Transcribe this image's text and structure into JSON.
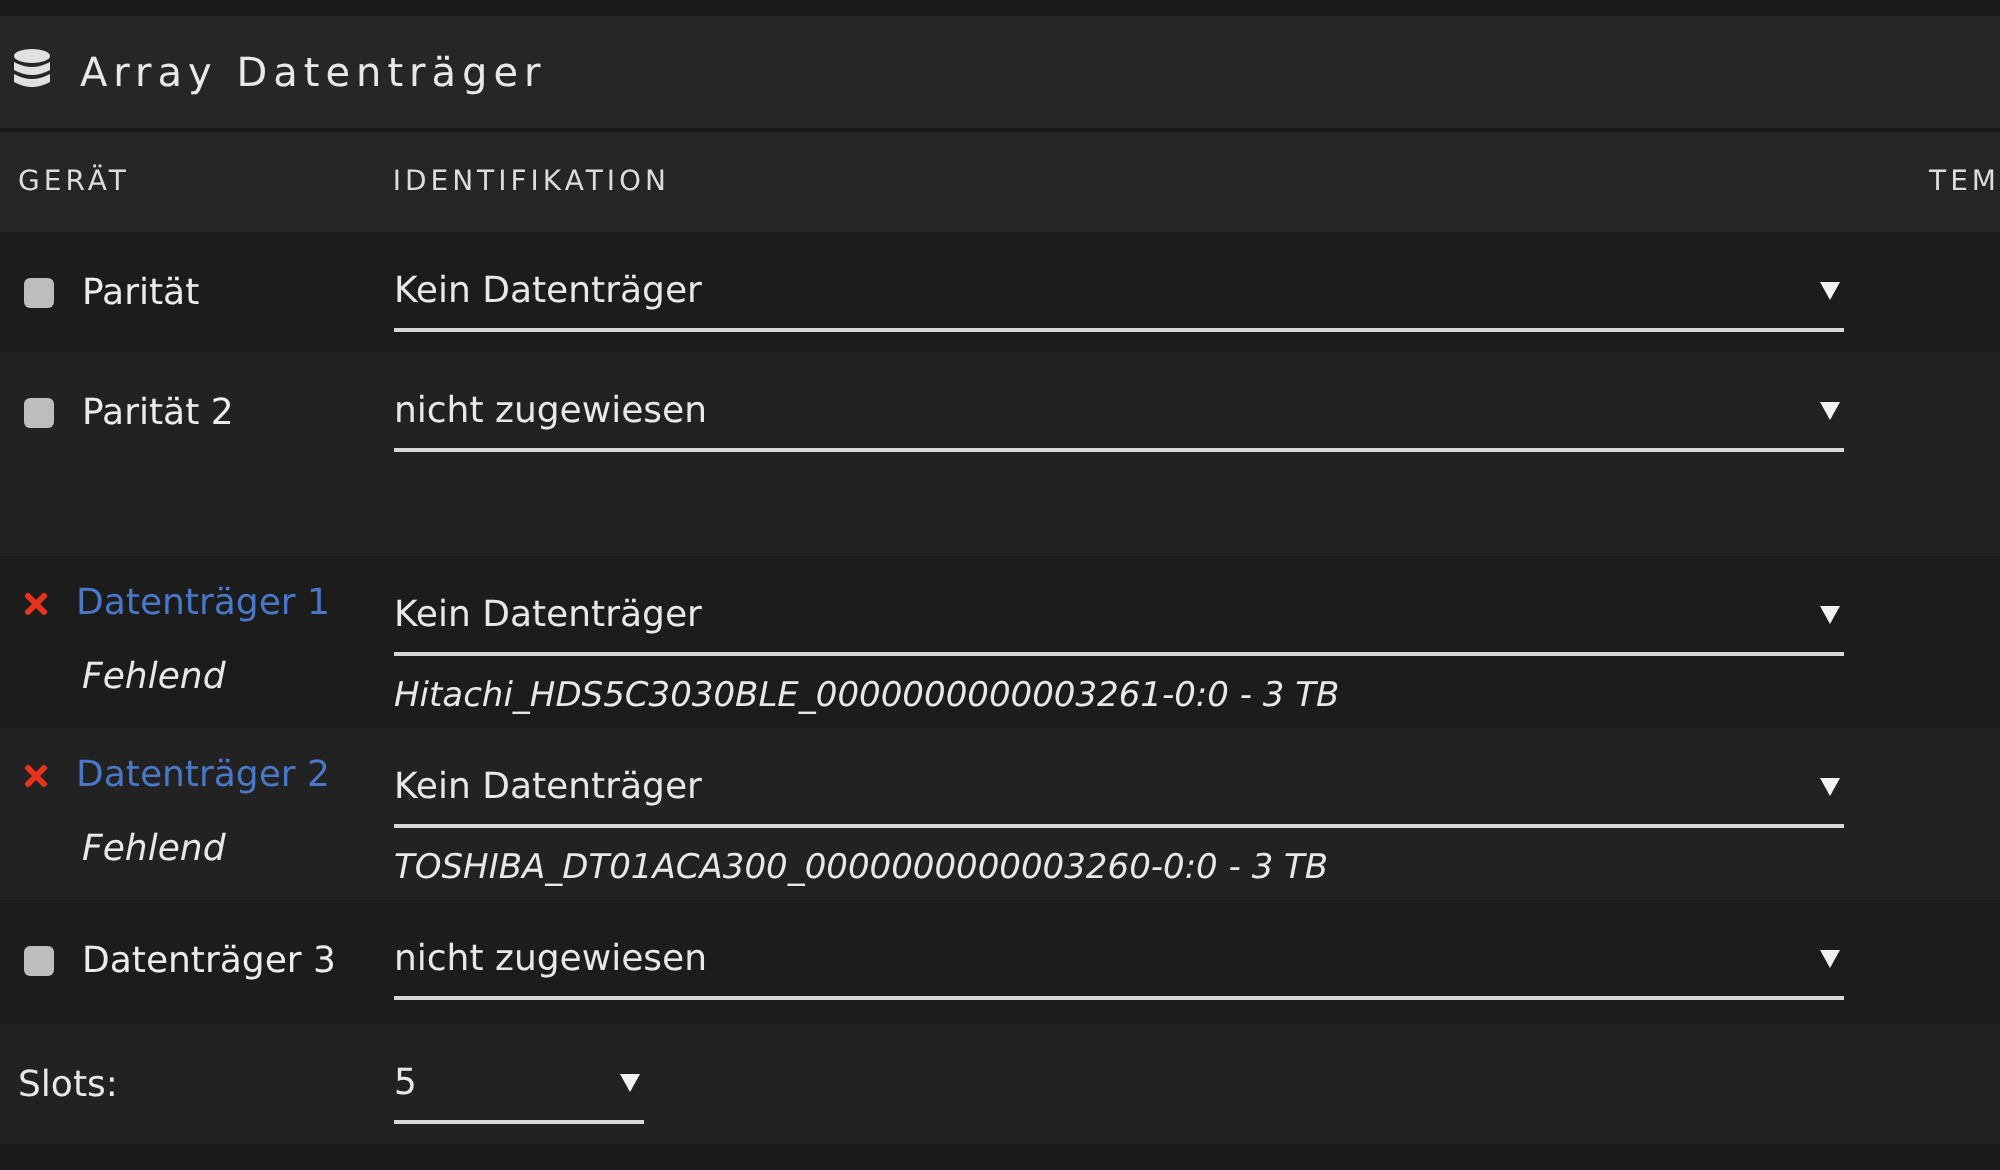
{
  "panel": {
    "title": "Array Datenträger"
  },
  "table": {
    "columns": [
      "GERÄT",
      "IDENTIFIKATION",
      "TEM"
    ],
    "groups": [
      [
        {
          "name": "Parität",
          "kind": "unassigned",
          "value": "Kein Datenträger"
        },
        {
          "name": "Parität 2",
          "kind": "unassigned",
          "value": "nicht zugewiesen"
        }
      ],
      [
        {
          "name": "Datenträger 1",
          "kind": "missing",
          "note": "Fehlend",
          "value": "Kein Datenträger",
          "expected": "Hitachi_HDS5C3030BLE_0000000000003261-0:0 - 3 TB"
        },
        {
          "name": "Datenträger 2",
          "kind": "missing",
          "note": "Fehlend",
          "value": "Kein Datenträger",
          "expected": "TOSHIBA_DT01ACA300_0000000000003260-0:0 - 3 TB"
        },
        {
          "name": "Datenträger 3",
          "kind": "unassigned",
          "value": "nicht zugewiesen"
        }
      ]
    ]
  },
  "slots": {
    "label": "Slots:",
    "value": "5"
  }
}
